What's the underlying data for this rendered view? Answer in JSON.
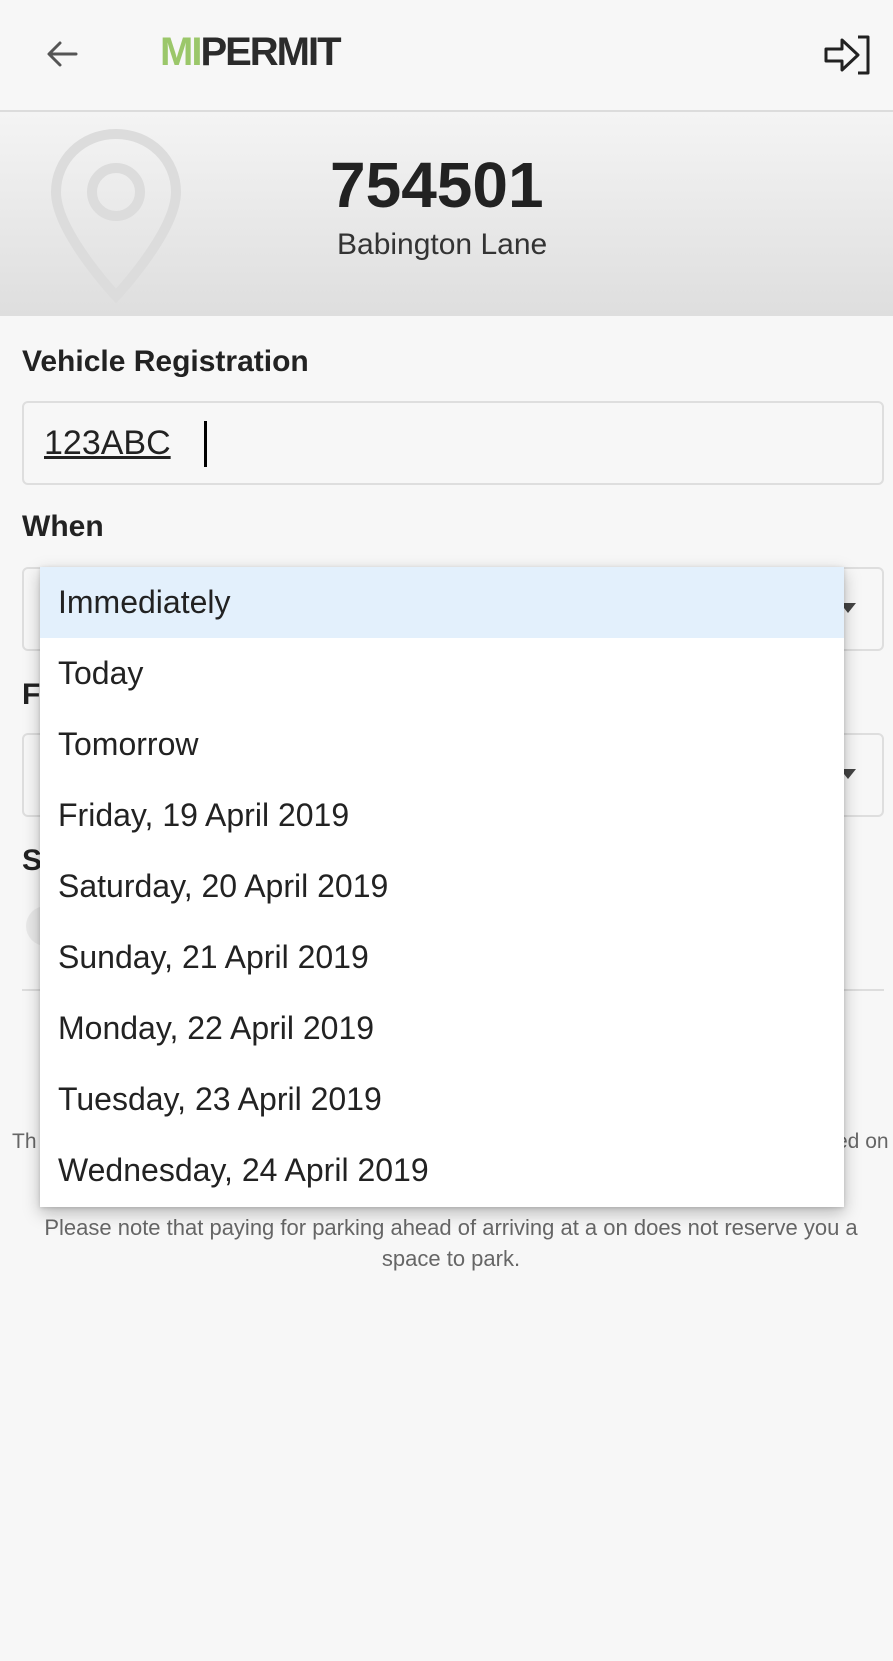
{
  "header": {
    "logo_mi": "MI",
    "logo_permit": "PERMIT",
    "back_icon": "arrow-left-icon",
    "logout_icon": "logout-icon"
  },
  "location": {
    "code": "754501",
    "street": "Babington Lane",
    "pin_icon": "map-pin-icon"
  },
  "form": {
    "vehicle_label": "Vehicle Registration",
    "vehicle_value": "123ABC",
    "when_label": "When",
    "for_label_partial": "F",
    "s_label_partial": "S"
  },
  "dropdown": {
    "selected_index": 0,
    "options": [
      "Immediately",
      "Today",
      "Tomorrow",
      "Friday, 19 April 2019",
      "Saturday, 20 April 2019",
      "Sunday, 21 April 2019",
      "Monday, 22 April 2019",
      "Tuesday, 23 April 2019",
      "Wednesday, 24 April 2019"
    ]
  },
  "notes": {
    "fragment_left": "Th",
    "fragment_right": "ed on",
    "reserve_note": "Please note that paying for parking ahead of arriving at a on does not reserve you a space to park."
  },
  "colors": {
    "logo_accent": "#9bc76a",
    "selected_option_bg": "#e3f0fc"
  }
}
